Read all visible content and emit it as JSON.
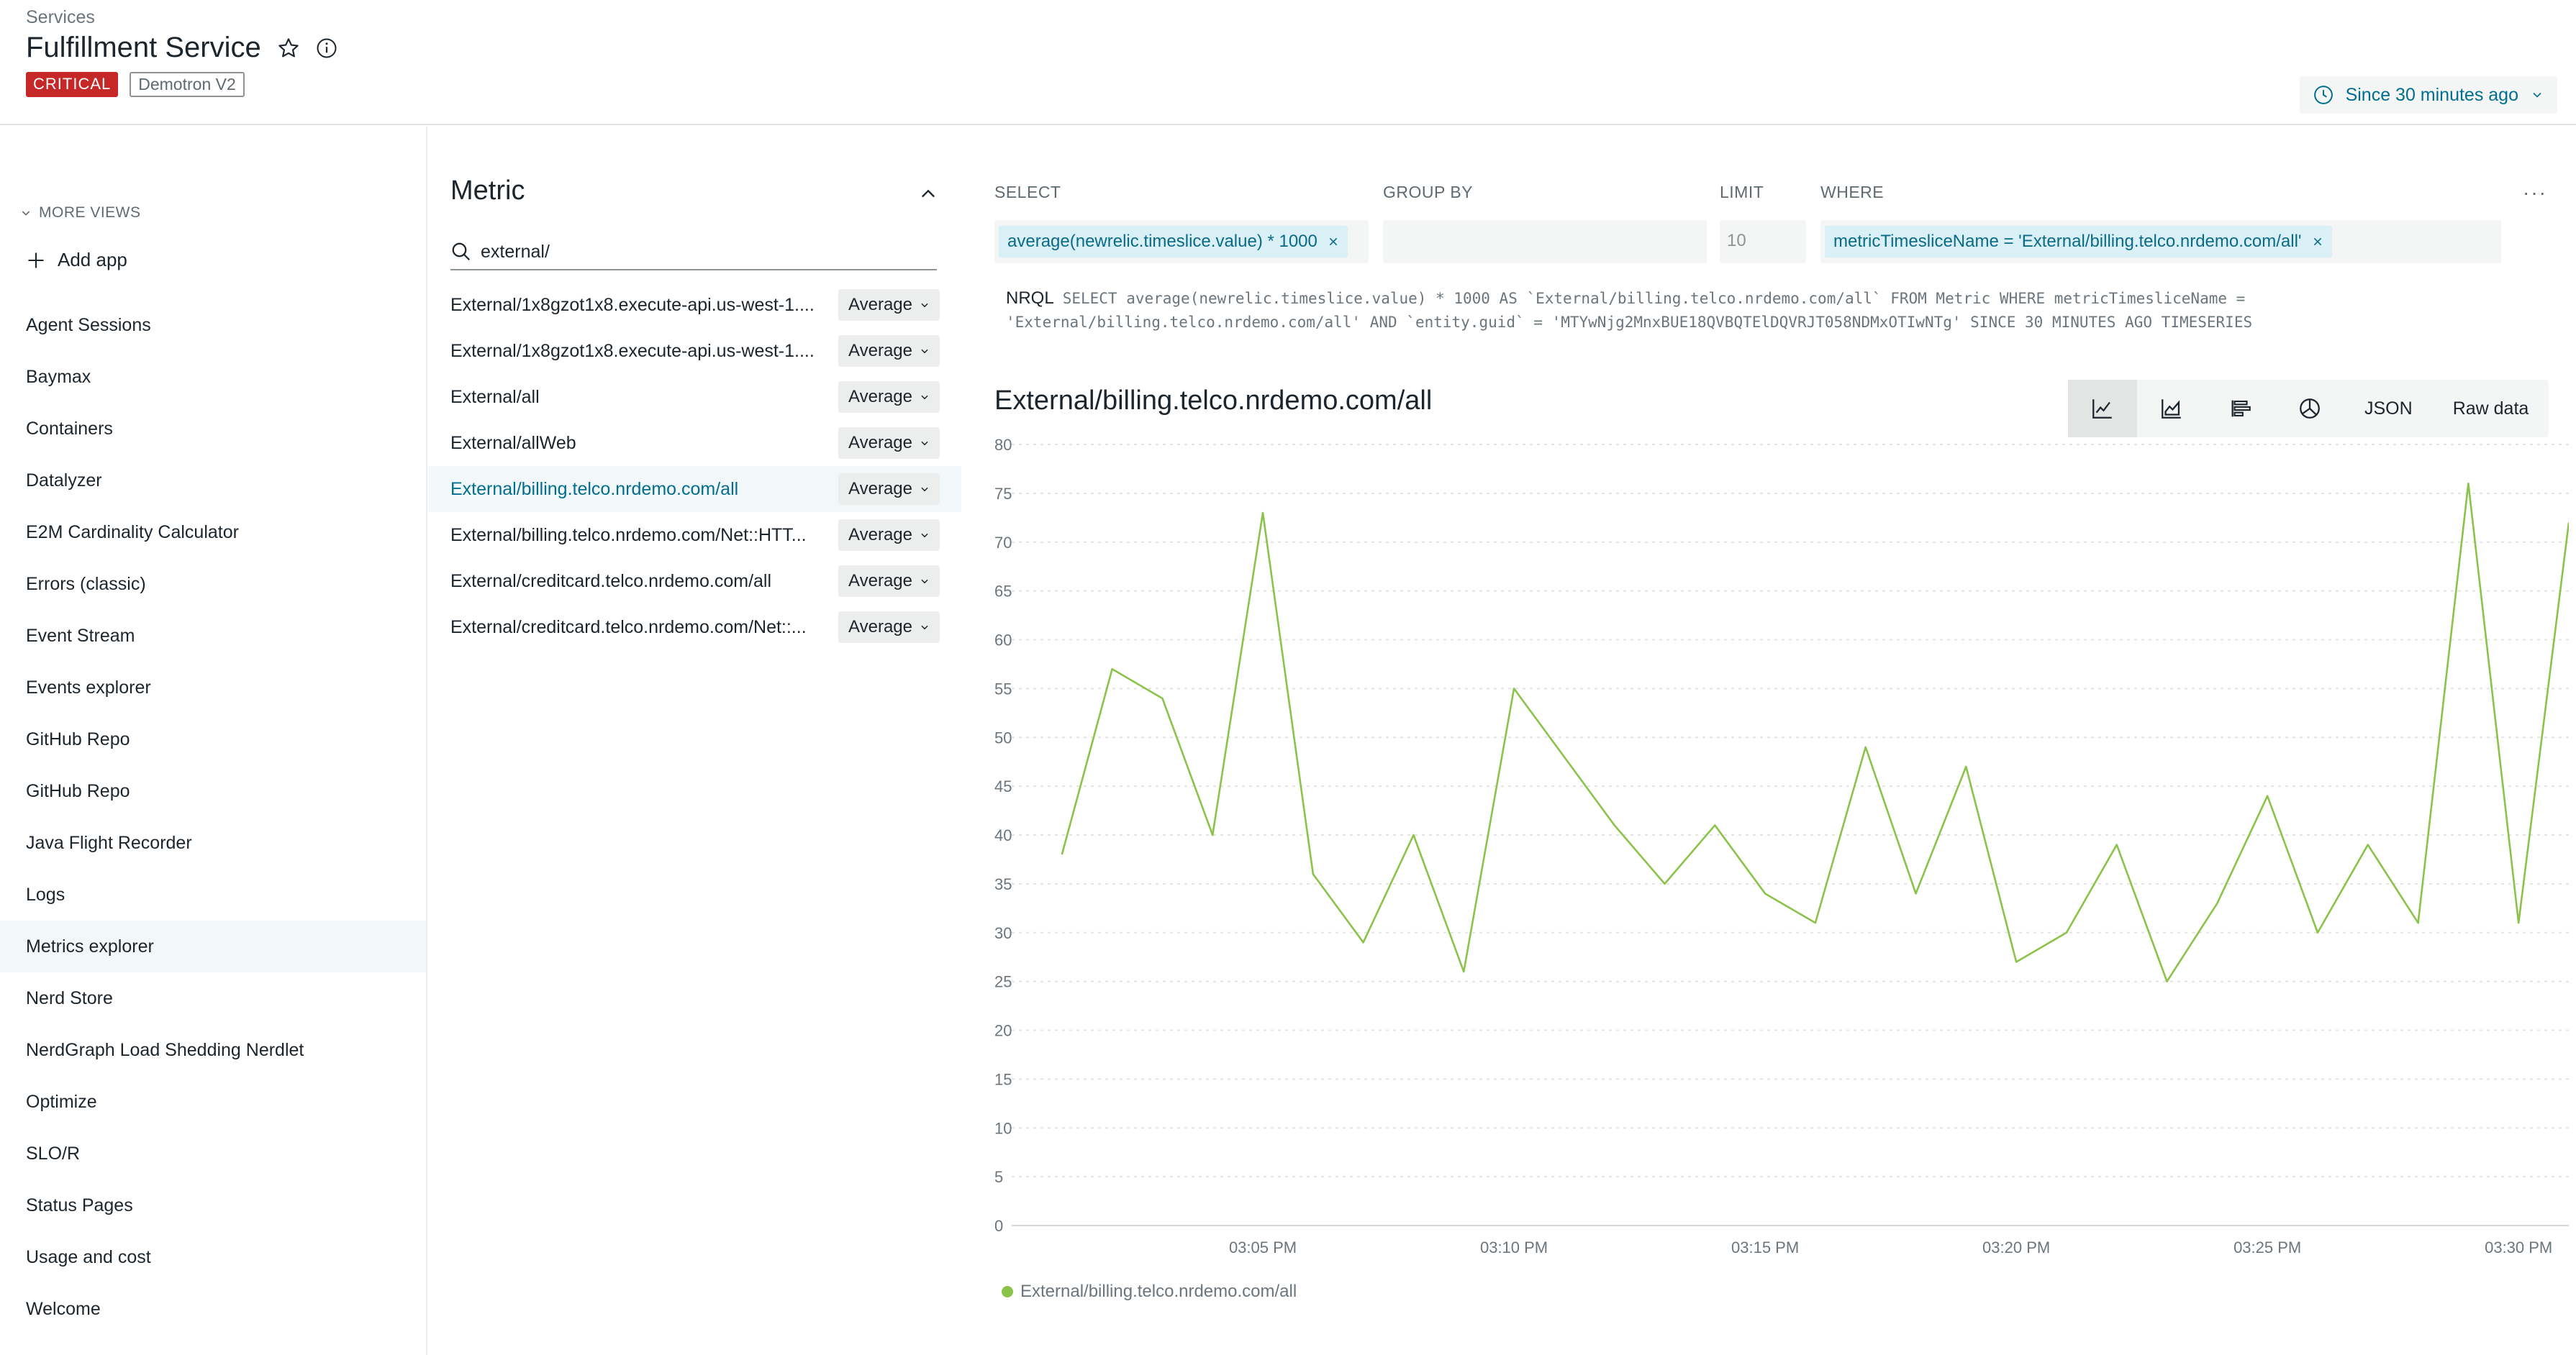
{
  "header": {
    "breadcrumb": "Services",
    "title": "Fulfillment Service",
    "status_badge": "CRITICAL",
    "account_badge": "Demotron V2",
    "time_picker": "Since 30 minutes ago"
  },
  "nav": {
    "more_views": "MORE VIEWS",
    "add_app": "Add app",
    "items": [
      {
        "label": "Agent Sessions"
      },
      {
        "label": "Baymax"
      },
      {
        "label": "Containers"
      },
      {
        "label": "Datalyzer"
      },
      {
        "label": "E2M Cardinality Calculator"
      },
      {
        "label": "Errors (classic)"
      },
      {
        "label": "Event Stream"
      },
      {
        "label": "Events explorer"
      },
      {
        "label": "GitHub Repo"
      },
      {
        "label": "GitHub Repo"
      },
      {
        "label": "Java Flight Recorder"
      },
      {
        "label": "Logs"
      },
      {
        "label": "Metrics explorer",
        "active": true
      },
      {
        "label": "Nerd Store"
      },
      {
        "label": "NerdGraph Load Shedding Nerdlet"
      },
      {
        "label": "Optimize"
      },
      {
        "label": "SLO/R"
      },
      {
        "label": "Status Pages"
      },
      {
        "label": "Usage and cost"
      },
      {
        "label": "Welcome"
      }
    ]
  },
  "metric_panel": {
    "heading": "Metric",
    "search_value": "external/",
    "aggregation_label": "Average",
    "rows": [
      {
        "name": "External/1x8gzot1x8.execute-api.us-west-1...."
      },
      {
        "name": "External/1x8gzot1x8.execute-api.us-west-1...."
      },
      {
        "name": "External/all"
      },
      {
        "name": "External/allWeb"
      },
      {
        "name": "External/billing.telco.nrdemo.com/all",
        "active": true
      },
      {
        "name": "External/billing.telco.nrdemo.com/Net::HTT..."
      },
      {
        "name": "External/creditcard.telco.nrdemo.com/all"
      },
      {
        "name": "External/creditcard.telco.nrdemo.com/Net::..."
      }
    ]
  },
  "query": {
    "select_label": "SELECT",
    "group_by_label": "GROUP BY",
    "limit_label": "LIMIT",
    "where_label": "WHERE",
    "select_value": "average(newrelic.timeslice.value) * 1000",
    "limit_value": "10",
    "where_value": "metricTimesliceName = 'External/billing.telco.nrdemo.com/all'",
    "nrql_label": "NRQL",
    "nrql_line1": "SELECT average(newrelic.timeslice.value) * 1000 AS `External/billing.telco.nrdemo.com/all` FROM Metric WHERE metricTimesliceName =",
    "nrql_line2": "'External/billing.telco.nrdemo.com/all' AND `entity.guid` = 'MTYwNjg2MnxBUE18QVBQTElDQVRJT058NDMxOTIwNTg' SINCE 30 MINUTES AGO TIMESERIES"
  },
  "chart_toolbar": {
    "json_label": "JSON",
    "raw_label": "Raw data"
  },
  "colors": {
    "series": "#8bc34a",
    "accent": "#006f8f",
    "critical": "#c62828"
  },
  "chart_data": {
    "type": "line",
    "title": "External/billing.telco.nrdemo.com/all",
    "x_ticks": [
      "03:05 PM",
      "03:10 PM",
      "03:15 PM",
      "03:20 PM",
      "03:25 PM",
      "03:30 PM"
    ],
    "x_tick_minutes": [
      5,
      10,
      15,
      20,
      25,
      30
    ],
    "ylim": [
      0,
      80
    ],
    "y_ticks": [
      0,
      5,
      10,
      15,
      20,
      25,
      30,
      35,
      40,
      45,
      50,
      55,
      60,
      65,
      70,
      75,
      80
    ],
    "grid": true,
    "legend": "bottom-left",
    "series": [
      {
        "name": "External/billing.telco.nrdemo.com/all",
        "x_minutes": [
          1,
          2,
          3,
          4,
          5,
          6,
          7,
          8,
          9,
          10,
          11,
          12,
          13,
          14,
          15,
          16,
          17,
          18,
          19,
          20,
          21,
          22,
          23,
          24,
          25,
          26,
          27,
          28,
          29,
          30,
          31
        ],
        "values": [
          38,
          57,
          54,
          40,
          73,
          36,
          29,
          40,
          26,
          55,
          48,
          41,
          35,
          41,
          34,
          31,
          49,
          34,
          47,
          27,
          30,
          39,
          25,
          33,
          44,
          30,
          39,
          31,
          76,
          31,
          72
        ]
      }
    ]
  }
}
